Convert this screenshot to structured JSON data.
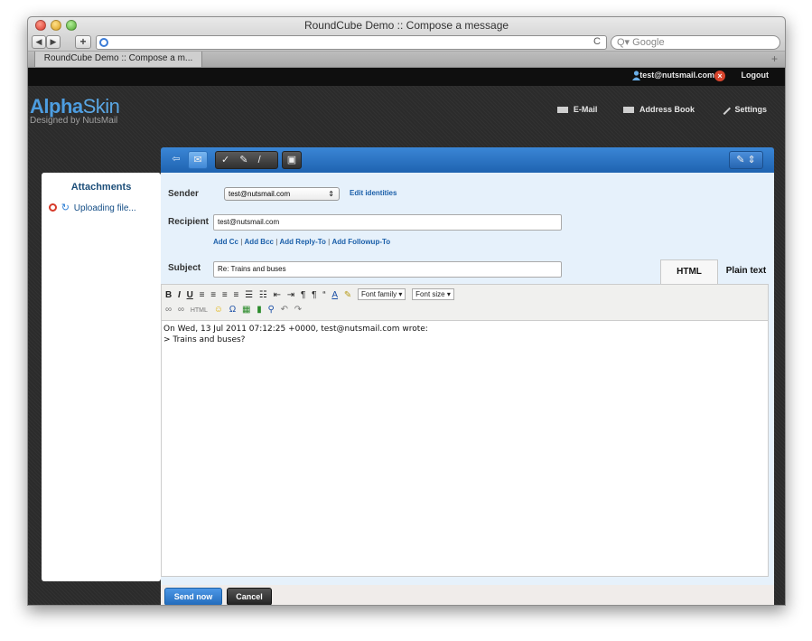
{
  "browser": {
    "window_title": "RoundCube Demo :: Compose a message",
    "tab_title": "RoundCube Demo :: Compose a m...",
    "search_placeholder": "Google",
    "search_prefix": "Q▾"
  },
  "app_header": {
    "user_email": "test@nutsmail.com",
    "logout_label": "Logout",
    "logo_bold": "Alpha",
    "logo_light": "Skin",
    "logo_tagline": "Designed by NutsMail",
    "nav": {
      "email": "E-Mail",
      "address_book": "Address Book",
      "settings": "Settings"
    }
  },
  "attachments": {
    "title": "Attachments",
    "uploading": "Uploading file..."
  },
  "compose": {
    "sender_label": "Sender",
    "sender_value": "test@nutsmail.com",
    "edit_identities": "Edit identities",
    "recipient_label": "Recipient",
    "recipient_value": "test@nutsmail.com",
    "add_cc": "Add Cc",
    "add_bcc": "Add Bcc",
    "add_reply_to": "Add Reply-To",
    "add_followup_to": "Add Followup-To",
    "subject_label": "Subject",
    "subject_value": "Re: Trains and buses",
    "format_tabs": {
      "html": "HTML",
      "plain": "Plain text"
    },
    "font_family": "Font family",
    "font_size": "Font size",
    "body_line1": "On Wed, 13 Jul 2011 07:12:25 +0000, test@nutsmail.com wrote:",
    "body_line2": "> Trains and buses?"
  },
  "buttons": {
    "send": "Send now",
    "cancel": "Cancel"
  },
  "colors": {
    "accent": "#2c74c6",
    "link": "#1b5fa9",
    "panel_bg": "#e6f1fb"
  }
}
